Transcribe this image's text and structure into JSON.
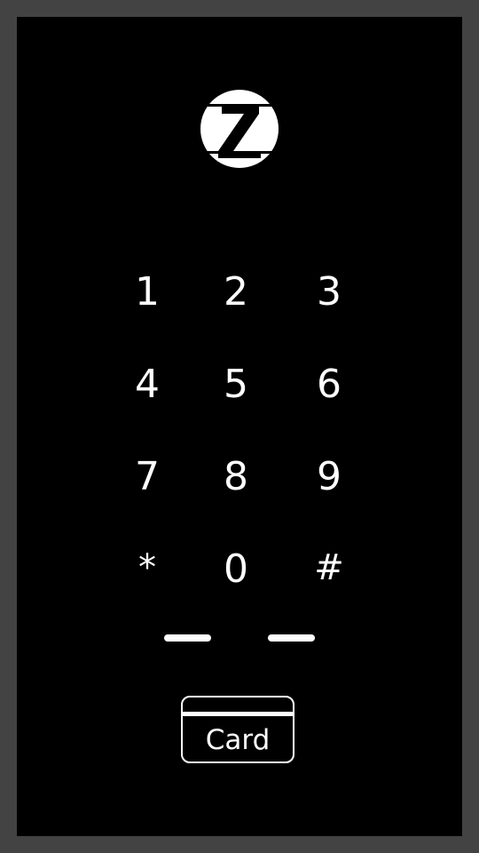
{
  "keypad": {
    "keys": [
      "1",
      "2",
      "3",
      "4",
      "5",
      "6",
      "7",
      "8",
      "9",
      "*",
      "0",
      "#"
    ]
  },
  "card": {
    "label": "Card"
  },
  "logo": {
    "icon": "z-logo-icon",
    "letter": "Z"
  },
  "colors": {
    "frame": "#434343",
    "screen": "#000000",
    "foreground": "#ffffff"
  }
}
